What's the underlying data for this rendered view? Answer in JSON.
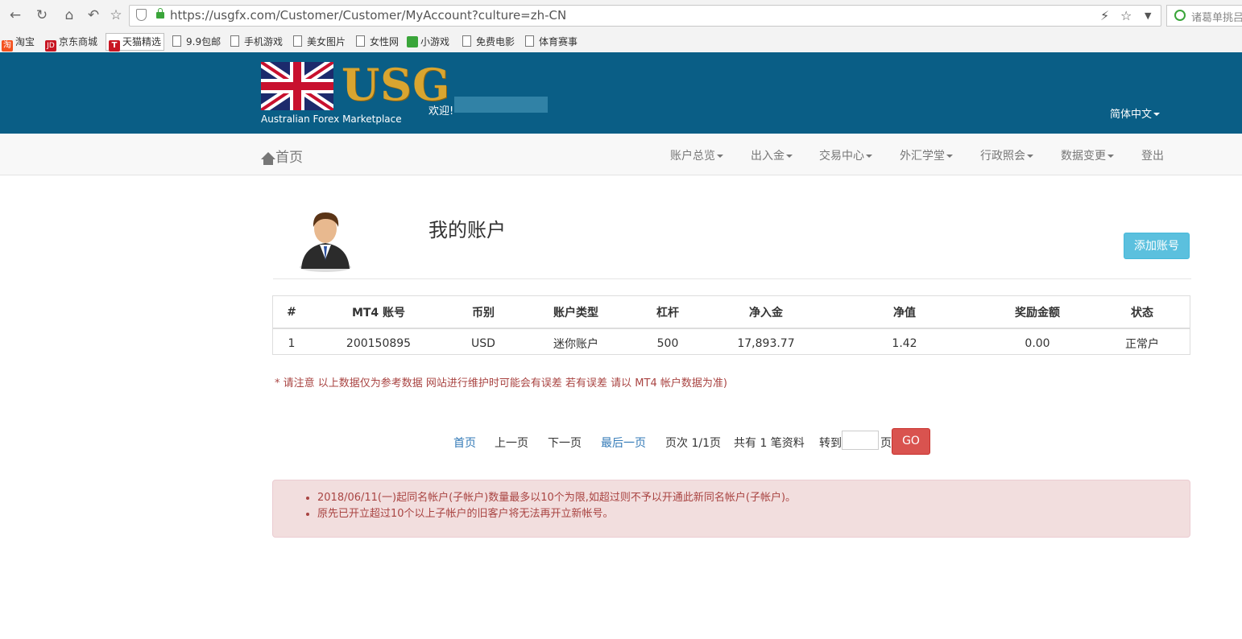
{
  "browser": {
    "url": "https://usgfx.com/Customer/Customer/MyAccount?culture=zh-CN",
    "search_placeholder": "诸葛单挑吕",
    "bookmarks": [
      {
        "label": "淘宝",
        "icon": "taobao-icon"
      },
      {
        "label": "京东商城",
        "icon": "jd-icon"
      },
      {
        "label": "天猫精选",
        "icon": "tmall-icon"
      },
      {
        "label": "9.9包邮",
        "icon": "page-icon"
      },
      {
        "label": "手机游戏",
        "icon": "page-icon"
      },
      {
        "label": "美女图片",
        "icon": "page-icon"
      },
      {
        "label": "女性网",
        "icon": "page-icon"
      },
      {
        "label": "小游戏",
        "icon": "game-icon"
      },
      {
        "label": "免费电影",
        "icon": "page-icon"
      },
      {
        "label": "体育赛事",
        "icon": "page-icon"
      }
    ]
  },
  "header": {
    "logo_text": "USG",
    "logo_sub": "Australian Forex Marketplace",
    "welcome": "欢迎!",
    "language": "简体中文"
  },
  "nav": {
    "home": "首页",
    "items": [
      "账户总览",
      "出入金",
      "交易中心",
      "外汇学堂",
      "行政照会",
      "数据变更",
      "登出"
    ]
  },
  "main": {
    "title": "我的账户",
    "add_button": "添加账号",
    "table": {
      "headers": [
        "#",
        "MT4 账号",
        "币别",
        "账户类型",
        "杠杆",
        "净入金",
        "净值",
        "奖励金额",
        "状态"
      ],
      "rows": [
        [
          "1",
          "200150895",
          "USD",
          "迷你账户",
          "500",
          "17,893.77",
          "1.42",
          "0.00",
          "正常户"
        ]
      ]
    },
    "note": "* 请注意 以上数据仅为参考数据 网站进行维护时可能会有误差 若有误差 请以 MT4 帐户数据为准)",
    "pager": {
      "first": "首页",
      "prev": "上一页",
      "next": "下一页",
      "last": "最后一页",
      "page_info": "页次 1/1页",
      "total": "共有 1 笔资料",
      "goto": "转到",
      "page_suffix": "页",
      "go": "GO"
    },
    "alerts": [
      "2018/06/11(一)起同名帐户(子帐户)数量最多以10个为限,如超过则不予以开通此新同名帐户(子帐户)。",
      "原先已开立超过10个以上子帐户的旧客户将无法再开立新帐号。"
    ]
  },
  "colors": {
    "header_bg": "#0a5e86",
    "info_button": "#5bc0de",
    "danger_button": "#d9534f",
    "alert_bg": "#f2dede",
    "alert_text": "#a94442",
    "link": "#337ab7"
  }
}
